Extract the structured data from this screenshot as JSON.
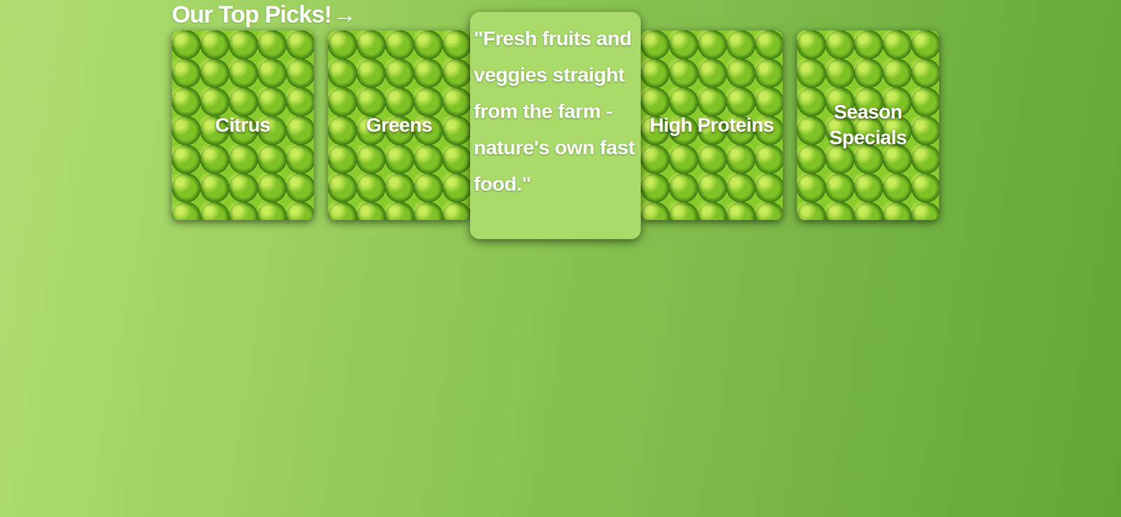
{
  "heading": {
    "title": "Our Top Picks!",
    "arrow": "→"
  },
  "cards": [
    {
      "kind": "category",
      "label": "Citrus"
    },
    {
      "kind": "category",
      "label": "Greens"
    },
    {
      "kind": "quote",
      "label": "\"Fresh fruits and veggies straight from the farm - nature's own fast food.\""
    },
    {
      "kind": "category",
      "label": "High Proteins"
    },
    {
      "kind": "category",
      "label": "Season Specials"
    }
  ]
}
